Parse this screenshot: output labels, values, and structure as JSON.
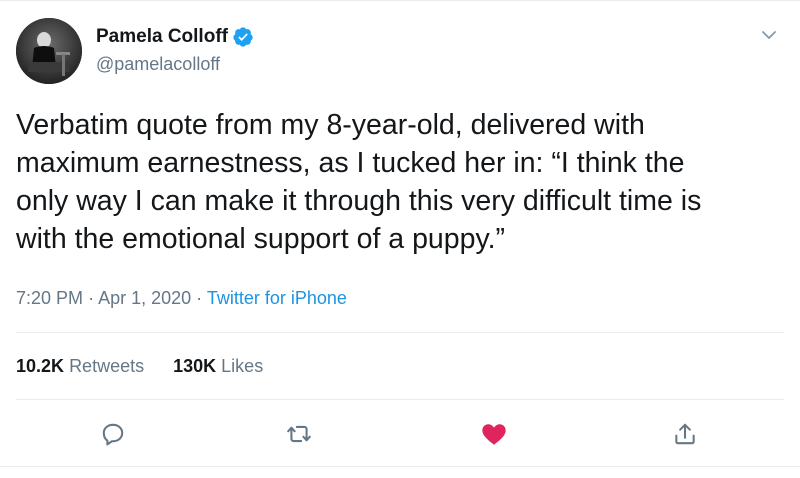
{
  "author": {
    "name": "Pamela Colloff",
    "handle": "@pamelacolloff",
    "verified": true
  },
  "tweet": {
    "text": "Verbatim quote from my 8-year-old, delivered with\nmaximum earnestness, as I tucked her in: “I think the\nonly way I can make it through this very difficult time is\nwith the emotional support of a puppy.”"
  },
  "meta": {
    "time": "7:20 PM",
    "sep1": "·",
    "date": "Apr 1, 2020",
    "sep2": "·",
    "source": "Twitter for iPhone"
  },
  "stats": {
    "retweets_count": "10.2K",
    "retweets_label": "Retweets",
    "likes_count": "130K",
    "likes_label": "Likes"
  },
  "actions": {
    "reply_icon": "reply-icon",
    "retweet_icon": "retweet-icon",
    "like_icon": "heart-icon",
    "share_icon": "share-icon",
    "liked": true
  },
  "colors": {
    "accent": "#1da1f2",
    "link": "#1b95e0",
    "muted": "#657786",
    "like": "#e0245e",
    "text": "#14171a"
  }
}
